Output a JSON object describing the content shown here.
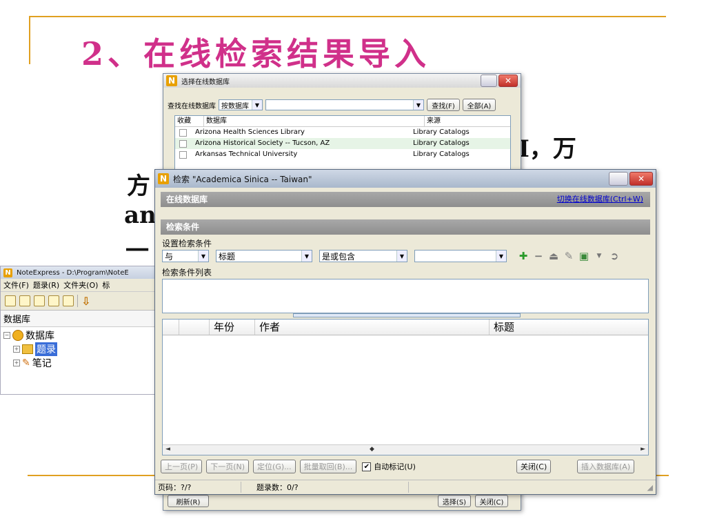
{
  "slide": {
    "title": "2、在线检索结果导入",
    "bg_lines": [
      "I，万",
      "方",
      "an",
      "一"
    ]
  },
  "select_db_dialog": {
    "title": "选择在线数据库",
    "search_label": "查找在线数据库",
    "search_by": "按数据库",
    "find_button": "查找(F)",
    "all_button": "全部(A)",
    "columns": [
      "收藏",
      "数据库",
      "来源"
    ],
    "rows": [
      {
        "name": "Arizona Health Sciences Library",
        "source": "Library Catalogs"
      },
      {
        "name": "Arizona Historical Society -- Tucson, AZ",
        "source": "Library Catalogs"
      },
      {
        "name": "Arkansas Technical University",
        "source": "Library Catalogs"
      }
    ],
    "refresh_button": "刷新(R)",
    "select_button": "选择(S)",
    "close_button": "关闭(C)"
  },
  "noteexpress": {
    "title": "NoteExpress - D:\\Program\\NoteE",
    "menu": [
      "文件(F)",
      "题录(R)",
      "文件夹(O)",
      "标"
    ],
    "tree_header": "数据库",
    "tree": [
      {
        "label": "数据库",
        "level": 0,
        "expander": "−"
      },
      {
        "label": "题录",
        "level": 1,
        "expander": "+",
        "selected": true
      },
      {
        "label": "笔记",
        "level": 1,
        "expander": "+"
      }
    ]
  },
  "search_window": {
    "title": "检索 \"Academica Sinica -- Taiwan\"",
    "online_db_label": "在线数据库",
    "switch_link": "切换在线数据库(Ctrl+W)",
    "criteria_header": "检索条件",
    "set_criteria_label": "设置检索条件",
    "logic": "与",
    "field": "标题",
    "operator": "是或包含",
    "value": "",
    "criteria_list_label": "检索条件列表",
    "columns": [
      "年份",
      "作者",
      "标题"
    ],
    "buttons": {
      "prev": "上一页(P)",
      "next": "下一页(N)",
      "locate": "定位(G)...",
      "batch": "批量取回(B)...",
      "auto_mark": "自动标记(U)",
      "close": "关闭(C)",
      "insert": "插入数据库(A)"
    },
    "auto_mark_checked": true,
    "status_page": "页码：?/?",
    "status_count": "题录数：0/?"
  },
  "colors": {
    "accent_rule": "#e0a020",
    "title_pink": "#d0308a",
    "section_gray": "#8e8e8e",
    "link_blue": "#0000cc"
  },
  "icons": [
    "add-icon",
    "remove-icon",
    "up-icon",
    "edit-icon",
    "save-icon",
    "go-icon"
  ]
}
